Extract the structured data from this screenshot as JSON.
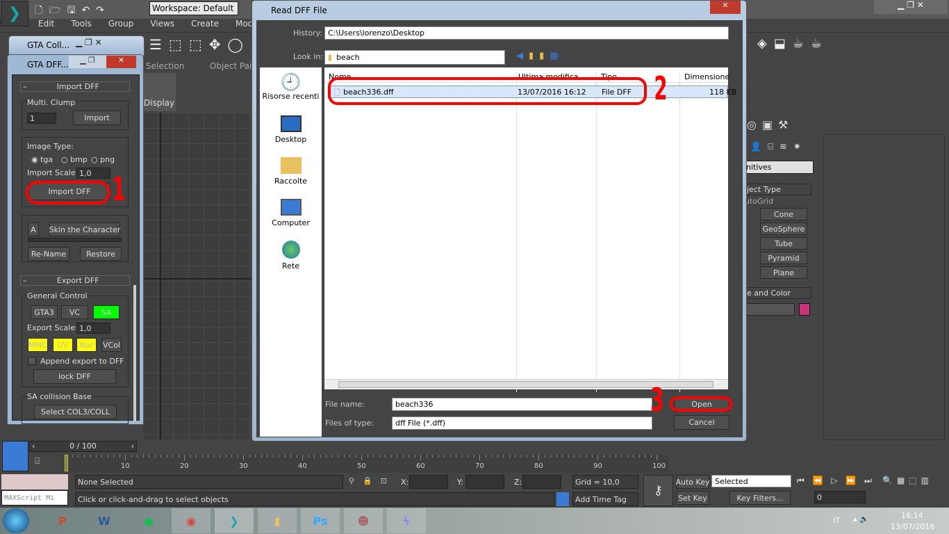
{
  "app": {
    "workspace": "Workspace: Default",
    "menu": [
      "Edit",
      "Tools",
      "Group",
      "Views",
      "Create",
      "Modifie"
    ],
    "ribbon": [
      "Selection",
      "Object Pain"
    ],
    "display_label": "Display"
  },
  "gta_coll": {
    "title": "GTA Coll..."
  },
  "gta_dff": {
    "title": "GTA DFF...",
    "import_section": "Import DFF",
    "multi_clump": "Multi. Clump",
    "clump_value": "1",
    "import_btn": "Import",
    "image_type": "Image Type:",
    "radios": [
      "tga",
      "bmp",
      "png"
    ],
    "radio_selected": "tga",
    "import_scale_label": "Import Scale:",
    "import_scale": "1,0",
    "import_dff_btn": "Import DFF",
    "a_btn": "A",
    "skin_btn": "Skin the Character",
    "rename_btn": "Re-Name",
    "restore_btn": "Restore",
    "export_section": "Export DFF",
    "general_control": "General Control",
    "game_btns": [
      "GTA3",
      "VC",
      "SA"
    ],
    "export_scale_label": "Export Scale:",
    "export_scale": "1,0",
    "flag_btns": [
      "MMC",
      "UV",
      "Nor",
      "VCol"
    ],
    "append_label": "Append export to DFF",
    "append_checked": false,
    "lock_btn": "lock DFF",
    "sa_collision": "SA collision Base",
    "select_col_btn": "Select COL3/COLL"
  },
  "dialog": {
    "title": "Read DFF File",
    "history_label": "History:",
    "history_value": "C:\\Users\\lorenzo\\Desktop",
    "lookin_label": "Look in:",
    "lookin_value": "beach",
    "places": [
      "Risorse recenti",
      "Desktop",
      "Raccolte",
      "Computer",
      "Rete"
    ],
    "columns": [
      "Nome",
      "Ultima modifica",
      "Tipo",
      "Dimensione"
    ],
    "files": [
      {
        "name": "beach336.dff",
        "modified": "13/07/2016 16:12",
        "type": "File DFF",
        "size": "118 KB"
      }
    ],
    "filename_label": "File name:",
    "filename_value": "beach336",
    "filetype_label": "Files of type:",
    "filetype_value": "dff File (*.dff)",
    "open_btn": "Open",
    "cancel_btn": "Cancel"
  },
  "annotations": [
    "1",
    "2",
    "3"
  ],
  "command_panel": {
    "dropdown": "nitives",
    "object_type": "ject Type",
    "autogrid": "utoGrid",
    "buttons": [
      "Cone",
      "GeoSphere",
      "Tube",
      "Pyramid",
      "Plane"
    ],
    "name_color": "e and Color",
    "color": "#c8327a"
  },
  "timeline": {
    "frame": "0 / 100",
    "ticks": [
      "0",
      "10",
      "20",
      "30",
      "40",
      "50",
      "60",
      "70",
      "80",
      "90",
      "100"
    ],
    "position": 0
  },
  "status": {
    "selection": "None Selected",
    "prompt": "Click or click-and-drag to select objects",
    "maxscript": "MAXScript Mi",
    "x_label": "X:",
    "y_label": "Y:",
    "z_label": "Z:",
    "grid": "Grid = 10,0",
    "add_time_tag": "Add Time Tag",
    "auto_key": "Auto Key",
    "set_key": "Set Key",
    "key_mode": "Selected",
    "key_filters": "Key Filters...",
    "frame_value": "0"
  },
  "taskbar": {
    "apps": [
      "PowerPoint",
      "Word",
      "Spotify",
      "Chrome",
      "3ds Max",
      "Explorer",
      "Photoshop",
      "GTA SA",
      "Flash"
    ],
    "lang": "IT",
    "time": "16:14",
    "date": "13/07/2016"
  }
}
